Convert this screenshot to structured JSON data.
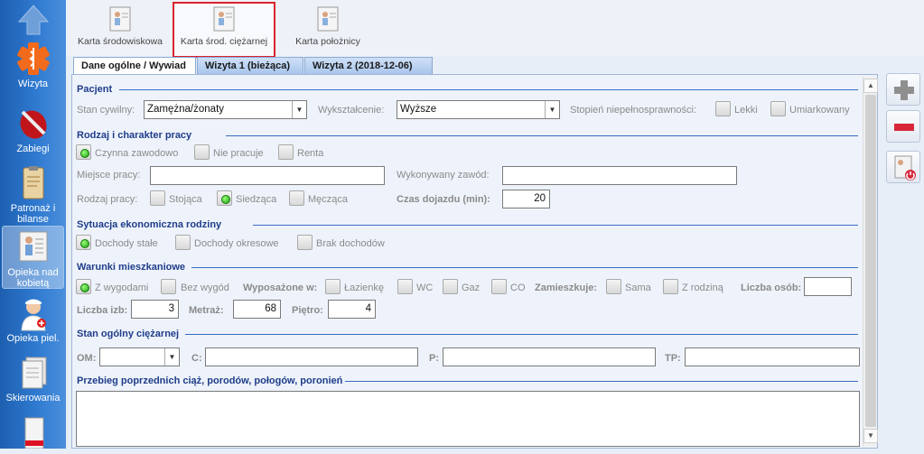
{
  "sidebar": {
    "items": [
      {
        "label": "Wizyta"
      },
      {
        "label": "Zabiegi"
      },
      {
        "label": "Patronaż i bilanse"
      },
      {
        "label": "Opieka nad kobietą"
      },
      {
        "label": "Opieka piel."
      },
      {
        "label": "Skierowania"
      }
    ]
  },
  "top_tabs": [
    {
      "label": "Karta środowiskowa"
    },
    {
      "label": "Karta środ. ciężarnej"
    },
    {
      "label": "Karta położnicy"
    }
  ],
  "sub_tabs": [
    {
      "label": "Dane ogólne / Wywiad"
    },
    {
      "label": "Wizyta 1 (bieżąca)"
    },
    {
      "label": "Wizyta 2 (2018-12-06)"
    }
  ],
  "pacjent": {
    "title": "Pacjent",
    "stan_label": "Stan cywilny:",
    "stan_value": "Zamężna/żonaty",
    "wyks_label": "Wykształcenie:",
    "wyks_value": "Wyższe",
    "stopien_label": "Stopień niepełnosprawności:",
    "lekki": "Lekki",
    "umiarkowany": "Umiarkowany"
  },
  "praca": {
    "title": "Rodzaj i charakter pracy",
    "czynna": "Czynna zawodowo",
    "nie_pracuje": "Nie pracuje",
    "renta": "Renta",
    "miejsce_label": "Miejsce pracy:",
    "miejsce_value": "",
    "zawod_label": "Wykonywany zawód:",
    "zawod_value": "",
    "rodzaj_label": "Rodzaj pracy:",
    "stojaca": "Stojąca",
    "siedzaca": "Siedząca",
    "meczaca": "Męcząca",
    "dojazd_label": "Czas dojazdu (min):",
    "dojazd_value": "20"
  },
  "ekonomia": {
    "title": "Sytuacja ekonomiczna rodziny",
    "stale": "Dochody stałe",
    "okresowe": "Dochody okresowe",
    "brak": "Brak dochodów"
  },
  "mieszkanie": {
    "title": "Warunki mieszkaniowe",
    "z_wygodami": "Z wygodami",
    "bez_wygod": "Bez wygód",
    "wyposazone_label": "Wyposażone w:",
    "lazienke": "Łazienkę",
    "wc": "WC",
    "gaz": "Gaz",
    "co": "CO",
    "zamieszkuje_label": "Zamieszkuje:",
    "sama": "Sama",
    "z_rodzina": "Z rodziną",
    "liczba_osob_label": "Liczba osób:",
    "liczba_osob_value": "",
    "liczba_izb_label": "Liczba izb:",
    "liczba_izb_value": "3",
    "metraz_label": "Metraż:",
    "metraz_value": "68",
    "pietro_label": "Piętro:",
    "pietro_value": "4"
  },
  "stan_ogolny": {
    "title": "Stan ogólny ciężarnej",
    "om_label": "OM:",
    "c_label": "C:",
    "p_label": "P:",
    "tp_label": "TP:"
  },
  "przebieg": {
    "title": "Przebieg poprzednich ciąż, porodów, połogów, poronień"
  },
  "colors": {
    "accent": "#1f3d8a",
    "sidebar": "#2f7ad0",
    "selection": "#d9232d"
  }
}
